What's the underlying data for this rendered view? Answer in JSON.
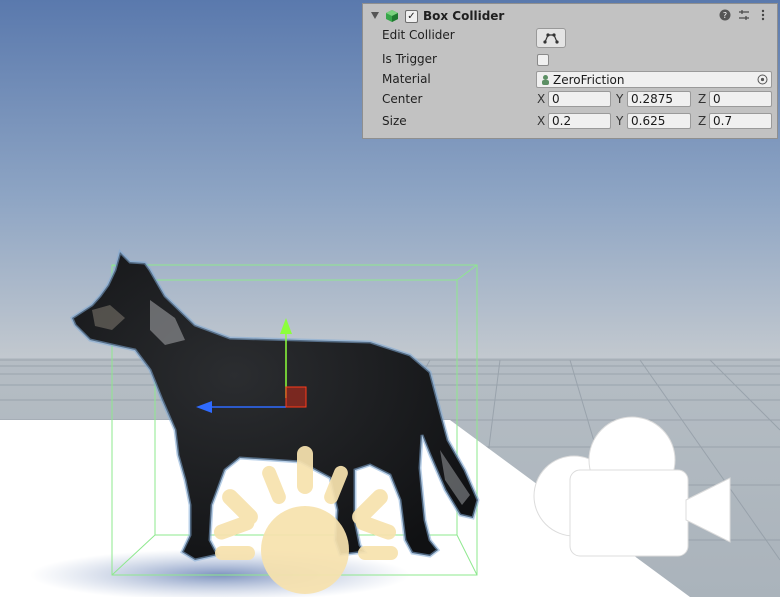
{
  "inspector": {
    "component_title": "Box Collider",
    "component_enabled": true,
    "rows": {
      "edit_collider": "Edit Collider",
      "is_trigger": "Is Trigger",
      "material": "Material",
      "center": "Center",
      "size": "Size"
    },
    "is_trigger_value": false,
    "material_value": "ZeroFriction",
    "axis": {
      "x": "X",
      "y": "Y",
      "z": "Z"
    },
    "center": {
      "x": "0",
      "y": "0.2875",
      "z": "0"
    },
    "size": {
      "x": "0.2",
      "y": "0.625",
      "z": "0.7"
    },
    "icons": {
      "component": "box-collider-icon",
      "help": "help-icon",
      "presets": "presets-icon",
      "menu": "kebab-menu-icon",
      "edit_collider": "edit-collider-icon",
      "material": "physic-material-icon",
      "picker": "object-picker-icon"
    }
  },
  "scene": {
    "objects": [
      "wolf-model",
      "box-collider-gizmo",
      "move-gizmo",
      "directional-light-gizmo",
      "camera-gizmo"
    ],
    "colors": {
      "sky_top": "#5a79ad",
      "sky_horizon": "#c3c9cf",
      "ground": "#a9b1b8",
      "collider": "#8ee88e",
      "gizmo_x": "#ff0000",
      "gizmo_y": "#8cff3a",
      "gizmo_z": "#2f6bff",
      "light_gizmo": "#f7e2ae"
    }
  }
}
